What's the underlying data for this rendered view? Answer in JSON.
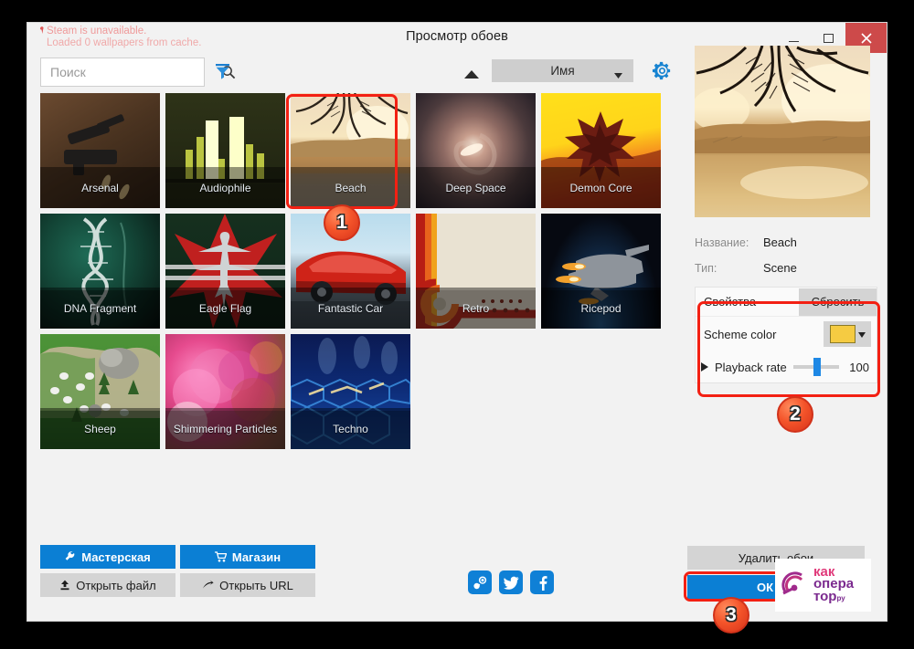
{
  "window": {
    "title": "Просмотр обоев",
    "minimize_label": "—",
    "maximize_label": "□",
    "close_label": "✕"
  },
  "status": {
    "line1": "Steam is unavailable.",
    "line2": "Loaded 0 wallpapers from cache.",
    "color": "#ef9a9a"
  },
  "toolbar": {
    "search_placeholder": "Поиск",
    "search_value": "",
    "search_icon": "search-icon",
    "filter_icon": "filter-icon",
    "sort_direction_icon": "sort-ascending-icon",
    "sort_value": "Имя",
    "settings_icon": "gear-icon"
  },
  "wallpapers": [
    {
      "name": "Arsenal",
      "selected": false
    },
    {
      "name": "Audiophile",
      "selected": false
    },
    {
      "name": "Beach",
      "selected": true
    },
    {
      "name": "Deep Space",
      "selected": false
    },
    {
      "name": "Demon Core",
      "selected": false
    },
    {
      "name": "DNA Fragment",
      "selected": false
    },
    {
      "name": "Eagle Flag",
      "selected": false
    },
    {
      "name": "Fantastic Car",
      "selected": false
    },
    {
      "name": "Retro",
      "selected": false
    },
    {
      "name": "Ricepod",
      "selected": false
    },
    {
      "name": "Sheep",
      "selected": false
    },
    {
      "name": "Shimmering Particles",
      "selected": false
    },
    {
      "name": "Techno",
      "selected": false
    }
  ],
  "details": {
    "name_label": "Название:",
    "name_value": "Beach",
    "type_label": "Тип:",
    "type_value": "Scene"
  },
  "properties": {
    "header": "Свойства",
    "reset_label": "Сбросить",
    "scheme_color_label": "Scheme color",
    "scheme_color_value": "#f5cb42",
    "scheme_color_caret": "▼",
    "playback_rate_label": "Playback rate",
    "playback_rate_value": "100"
  },
  "bottom": {
    "workshop_label": "Мастерская",
    "workshop_icon": "wrench-icon",
    "store_label": "Магазин",
    "store_icon": "cart-icon",
    "open_file_label": "Открыть файл",
    "open_file_icon": "upload-icon",
    "open_url_label": "Открыть URL",
    "open_url_icon": "arrow-icon",
    "delete_label": "Удалить обои",
    "ok_label": "ОК"
  },
  "socials": [
    {
      "name": "steam-icon",
      "glyph": "◉"
    },
    {
      "name": "twitter-icon",
      "glyph": "🐦"
    },
    {
      "name": "facebook-icon",
      "glyph": "f"
    }
  ],
  "annotations": {
    "badges": [
      "1",
      "2",
      "3"
    ],
    "highlight_color": "#f32013"
  },
  "watermark": {
    "line1": "как",
    "line2": "опера",
    "line3": "тор",
    "suffix": "ру"
  }
}
